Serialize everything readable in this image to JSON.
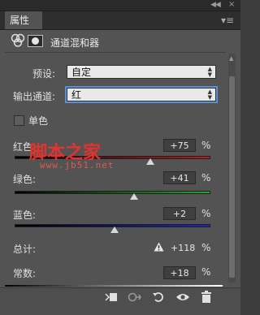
{
  "panel": {
    "tab_label": "属性",
    "title": "通道混和器"
  },
  "preset": {
    "label": "预设:",
    "value": "自定"
  },
  "output_channel": {
    "label": "输出通道:",
    "value": "红"
  },
  "monochrome": {
    "label": "单色",
    "checked": false
  },
  "sliders": [
    {
      "label": "红色:",
      "value": "+75",
      "pct": "%",
      "level_percent": 75
    },
    {
      "label": "绿色:",
      "value": "+41",
      "pct": "%",
      "level_percent": 41
    },
    {
      "label": "蓝色:",
      "value": "+2",
      "pct": "%",
      "level_percent": 2
    }
  ],
  "total": {
    "label": "总计:",
    "warning_icon": "warning-icon",
    "value": "+118",
    "pct": "%"
  },
  "constant": {
    "label": "常数:",
    "value": "+18",
    "pct": "%",
    "level_percent": 18
  },
  "watermark": {
    "text": "脚本之家",
    "url": "www.jb51.net"
  },
  "bottom_icons": [
    "clip-to-layer-icon",
    "view-previous-state-icon",
    "reset-icon",
    "visibility-eye-icon",
    "delete-trash-icon"
  ],
  "colors": {
    "panel_bg": "#535353",
    "red_track": "#c21b1b",
    "green_track": "#28a428",
    "blue_track": "#2323c8",
    "focus_outline": "#5b8fd6"
  }
}
